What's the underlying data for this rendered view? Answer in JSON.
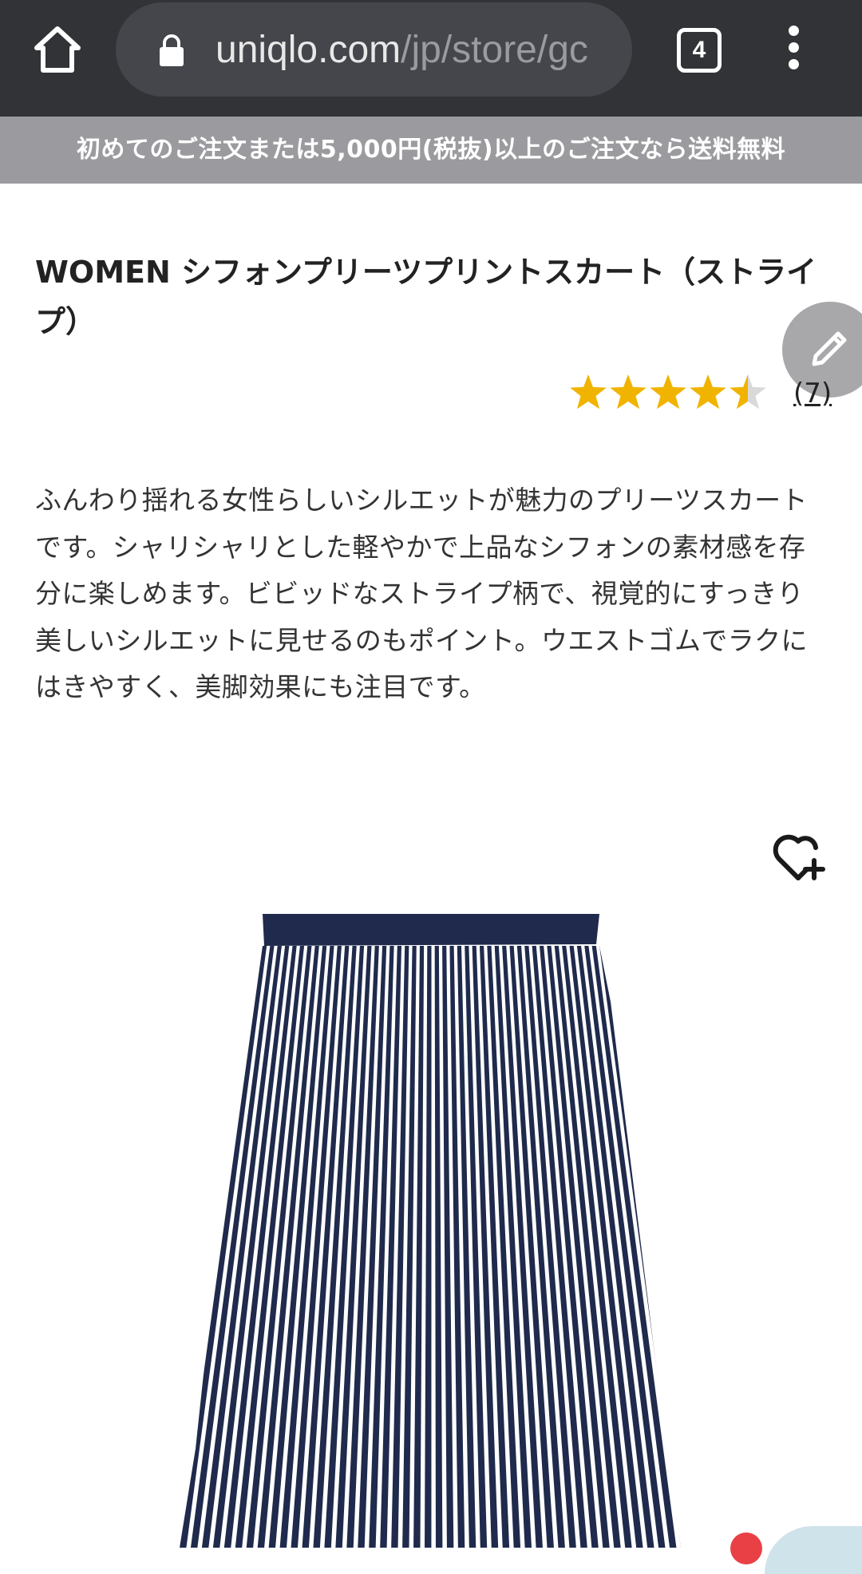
{
  "browser": {
    "url_host": "uniqlo.com",
    "url_path": "/jp/store/gc",
    "tab_count": "4",
    "icons": {
      "home": "home-icon",
      "lock": "lock-icon",
      "tabs": "tab-switcher-icon",
      "menu": "more-vert-icon"
    }
  },
  "promo_banner": {
    "text": "初めてのご注文または5,000円(税抜)以上のご注文なら送料無料"
  },
  "product": {
    "title": "WOMEN シフォンプリーツプリントスカート（ストライプ）",
    "rating_value": 4.5,
    "rating_max": 5,
    "review_count": "(7)",
    "description": "ふんわり揺れる女性らしいシルエットが魅力のプリーツスカートです。シャリシャリとした軽やかで上品なシフォンの素材感を存分に楽しめます。ビビッドなストライプ柄で、視覚的にすっきり美しいシルエットに見せるのもポイント。ウエストゴムでラクにはきやすく、美脚効果にも注目です。",
    "image_icon": "striped-pleated-skirt-image",
    "wishlist_icon": "heart-plus-icon",
    "edit_icon": "pencil-icon"
  },
  "colors": {
    "chrome": "#323337",
    "urlbar": "#45464b",
    "promo": "#9b9b9f",
    "star": "#f0b400",
    "star_empty": "#d9d9d9",
    "skirt_navy": "#1f2a4c"
  }
}
